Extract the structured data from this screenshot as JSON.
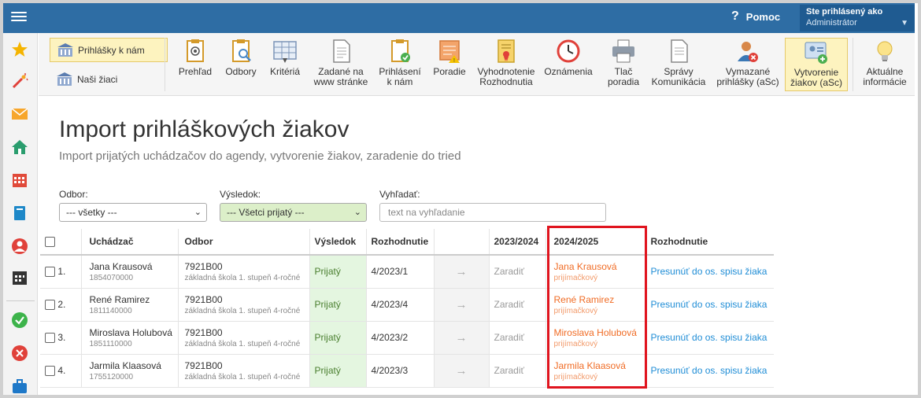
{
  "topbar": {
    "help_label": "Pomoc",
    "user_line1": "Ste prihlásený ako",
    "user_line2": "Administrátor"
  },
  "toolbar": {
    "left": [
      {
        "label": "Prihlášky k nám",
        "active": true
      },
      {
        "label": "Naši žiaci",
        "active": false
      }
    ],
    "buttons": [
      {
        "label_1": "Prehľad",
        "label_2": "",
        "icon": "overview-icon"
      },
      {
        "label_1": "Odbory",
        "label_2": "",
        "icon": "fields-icon"
      },
      {
        "label_1": "Kritériá",
        "label_2": "",
        "icon": "criteria-icon"
      },
      {
        "label_1": "Zadané na",
        "label_2": "www stránke",
        "icon": "document-icon"
      },
      {
        "label_1": "Prihlásení",
        "label_2": "k nám",
        "icon": "registered-icon"
      },
      {
        "label_1": "Poradie",
        "label_2": "",
        "icon": "ranking-icon"
      },
      {
        "label_1": "Vyhodnotenie",
        "label_2": "Rozhodnutia",
        "icon": "evaluation-icon"
      },
      {
        "label_1": "Oznámenia",
        "label_2": "",
        "icon": "clock-icon"
      },
      {
        "label_1": "Tlač",
        "label_2": "poradia",
        "icon": "printer-icon"
      },
      {
        "label_1": "Správy",
        "label_2": "Komunikácia",
        "icon": "messages-icon"
      },
      {
        "label_1": "Vymazané",
        "label_2": "prihlášky (aSc)",
        "icon": "deleted-user-icon"
      },
      {
        "label_1": "Vytvorenie",
        "label_2": "žiakov (aSc)",
        "icon": "create-students-icon"
      },
      {
        "label_1": "Aktuálne",
        "label_2": "informácie",
        "icon": "lightbulb-icon"
      }
    ]
  },
  "page": {
    "title": "Import prihláškových žiakov",
    "subtitle": "Import prijatých uchádzačov do agendy, vytvorenie žiakov, zaradenie do tried"
  },
  "filters": {
    "odbor_label": "Odbor:",
    "odbor_value": "--- všetky ---",
    "vysledok_label": "Výsledok:",
    "vysledok_value": "--- Všetci prijatý ---",
    "search_label": "Vyhľadať:",
    "search_placeholder": "text na vyhľadanie"
  },
  "table": {
    "headers": {
      "uchadzac": "Uchádzač",
      "odbor": "Odbor",
      "vysledok": "Výsledok",
      "rozhodnutie": "Rozhodnutie",
      "year1": "2023/2024",
      "year2": "2024/2025",
      "rozhodnutie2": "Rozhodnutie"
    },
    "rows": [
      {
        "num": "1.",
        "name": "Jana Krausová",
        "id": "1854070000",
        "odbor_code": "7921B00",
        "odbor_desc": "základná škola 1. stupeň 4-ročné",
        "vysledok": "Prijatý",
        "rozhodnutie": "4/2023/1",
        "arrow": "→",
        "y1": "Zaradiť",
        "y2_name": "Jana Krausová",
        "y2_sub": "prijímačkový",
        "action": "Presunúť do os. spisu žiaka"
      },
      {
        "num": "2.",
        "name": "René Ramirez",
        "id": "1811140000",
        "odbor_code": "7921B00",
        "odbor_desc": "základná škola 1. stupeň 4-ročné",
        "vysledok": "Prijatý",
        "rozhodnutie": "4/2023/4",
        "arrow": "→",
        "y1": "Zaradiť",
        "y2_name": "René Ramirez",
        "y2_sub": "prijímačkový",
        "action": "Presunúť do os. spisu žiaka"
      },
      {
        "num": "3.",
        "name": "Miroslava Holubová",
        "id": "1851110000",
        "odbor_code": "7921B00",
        "odbor_desc": "základná škola 1. stupeň 4-ročné",
        "vysledok": "Prijatý",
        "rozhodnutie": "4/2023/2",
        "arrow": "→",
        "y1": "Zaradiť",
        "y2_name": "Miroslava Holubová",
        "y2_sub": "prijímačkový",
        "action": "Presunúť do os. spisu žiaka"
      },
      {
        "num": "4.",
        "name": "Jarmila Klaasová",
        "id": "1755120000",
        "odbor_code": "7921B00",
        "odbor_desc": "základná škola 1. stupeň 4-ročné",
        "vysledok": "Prijatý",
        "rozhodnutie": "4/2023/3",
        "arrow": "→",
        "y1": "Zaradiť",
        "y2_name": "Jarmila Klaasová",
        "y2_sub": "prijímačkový",
        "action": "Presunúť do os. spisu žiaka"
      }
    ]
  },
  "sidebar_icons": [
    "star-icon",
    "magic-wand-icon",
    "mail-icon",
    "home-icon",
    "calendar-icon",
    "book-icon",
    "person-icon",
    "schedule-icon",
    "check-icon",
    "cancel-icon",
    "briefcase-icon"
  ],
  "colors": {
    "topbar": "#2e6da4",
    "accent_orange": "#f06c25",
    "link_blue": "#1f8dd6",
    "highlight_red": "#e0141e",
    "result_green": "#e4f6e0"
  }
}
